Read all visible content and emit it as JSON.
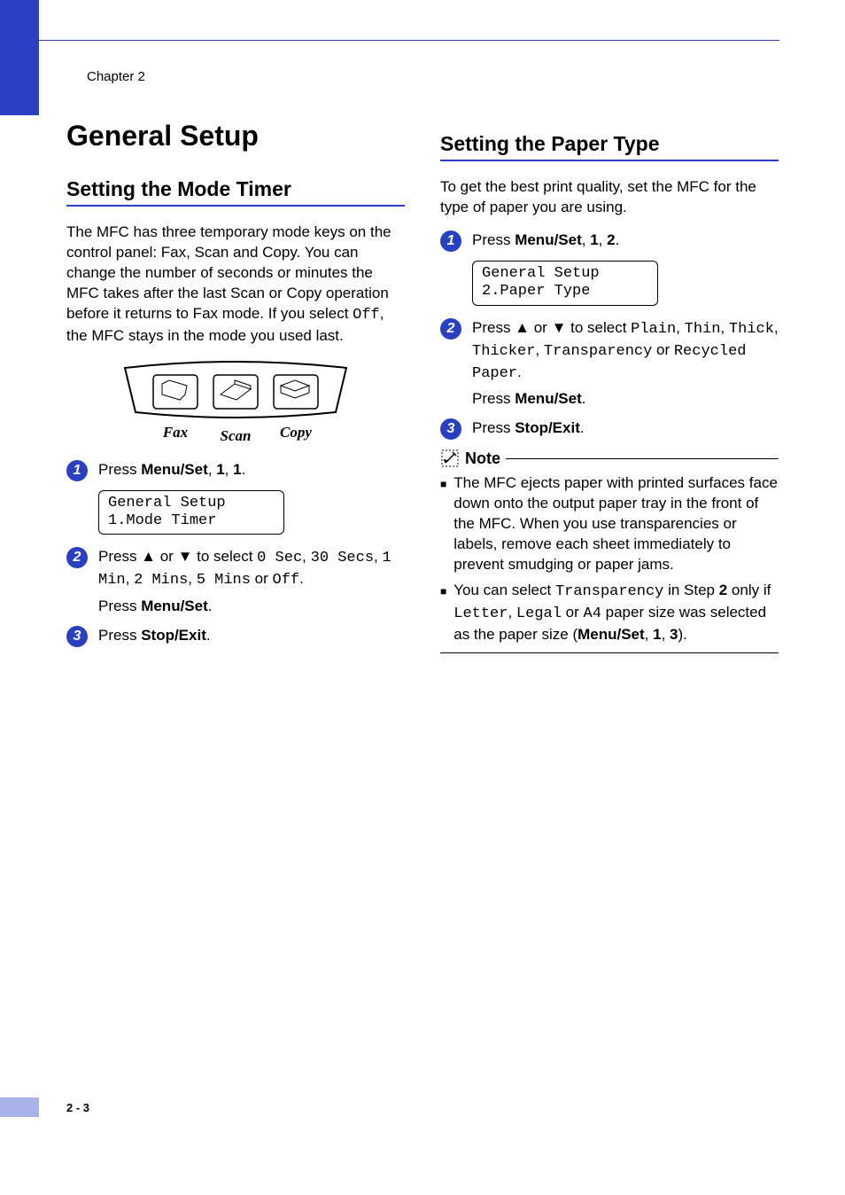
{
  "chapter_label": "Chapter 2",
  "page_number": "2 - 3",
  "left": {
    "h1": "General Setup",
    "h2": "Setting the Mode Timer",
    "intro_pre": "The MFC has three temporary mode keys on the control panel: Fax, Scan and Copy. You can change the number of seconds or minutes the MFC takes after the last Scan or Copy operation before it returns to Fax mode. If you select ",
    "intro_mono": "Off",
    "intro_post": ", the MFC stays in the mode you used last.",
    "panel_labels": {
      "fax": "Fax",
      "scan": "Scan",
      "copy": "Copy"
    },
    "step1": {
      "press": "Press ",
      "b1": "Menu/Set",
      "sep1": ", ",
      "b2": "1",
      "sep2": ", ",
      "b3": "1",
      "end": "."
    },
    "lcd": {
      "line1": "General Setup",
      "line2": "1.Mode Timer"
    },
    "step2": {
      "press": "Press ▲ or ▼ to select ",
      "opts": [
        "0 Sec",
        "30 Secs",
        "1 Min",
        "2 Mins",
        "5 Mins",
        "Off"
      ],
      "or": " or ",
      "comma": ", ",
      "end": ".",
      "press2_pre": "Press ",
      "press2_b": "Menu/Set",
      "press2_end": "."
    },
    "step3": {
      "press": "Press ",
      "b": "Stop/Exit",
      "end": "."
    }
  },
  "right": {
    "h2": "Setting the Paper Type",
    "intro": "To get the best print quality, set the MFC for the type of paper you are using.",
    "step1": {
      "press": "Press ",
      "b1": "Menu/Set",
      "sep1": ", ",
      "b2": "1",
      "sep2": ", ",
      "b3": "2",
      "end": "."
    },
    "lcd": {
      "line1": "General Setup",
      "line2": "2.Paper Type"
    },
    "step2": {
      "press": "Press ▲ or ▼ to select ",
      "opts": [
        "Plain",
        "Thin",
        "Thick",
        "Thicker",
        "Transparency",
        "Recycled Paper"
      ],
      "or": " or ",
      "comma": ", ",
      "end": ".",
      "press2_pre": "Press ",
      "press2_b": "Menu/Set",
      "press2_end": "."
    },
    "step3": {
      "press": "Press ",
      "b": "Stop/Exit",
      "end": "."
    },
    "note_label": "Note",
    "note1": "The MFC ejects paper with printed surfaces face down onto the output paper tray in the front of the MFC. When you use transparencies or labels, remove each sheet immediately to prevent smudging or paper jams.",
    "note2": {
      "pre": "You can select ",
      "mono1": "Transparency",
      "mid1": " in Step ",
      "b_step": "2",
      "mid2": " only if ",
      "mono2": "Letter",
      "c1": ", ",
      "mono3": "Legal",
      "or": " or ",
      "mono4": "A4",
      "mid3": " paper size was selected as the paper size (",
      "b1": "Menu/Set",
      "s1": ", ",
      "b2": "1",
      "s2": ", ",
      "b3": "3",
      "end": ")."
    }
  }
}
